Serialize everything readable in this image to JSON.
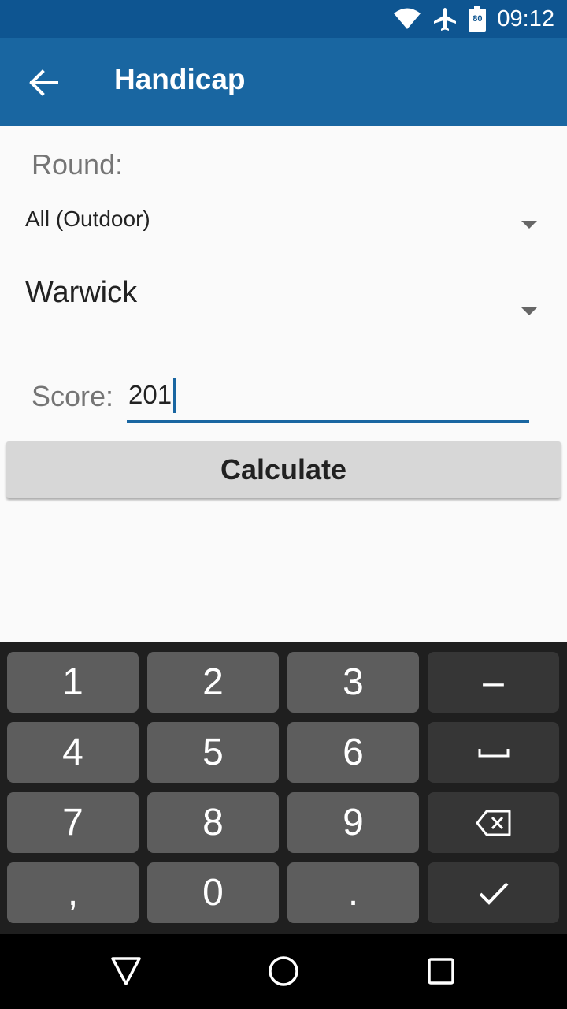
{
  "status_bar": {
    "time": "09:12",
    "battery_level": "80",
    "icons": [
      "wifi-icon",
      "airplane-icon",
      "battery-icon"
    ]
  },
  "app_bar": {
    "title": "Handicap",
    "back_icon": "arrow-left-icon"
  },
  "form": {
    "round_label": "Round:",
    "round_category": "All (Outdoor)",
    "round_name": "Warwick",
    "score_label": "Score:",
    "score_value": "201",
    "calculate_label": "Calculate"
  },
  "keyboard": {
    "keys": {
      "k1": "1",
      "k2": "2",
      "k3": "3",
      "minus": "–",
      "k4": "4",
      "k5": "5",
      "k6": "6",
      "k7": "7",
      "k8": "8",
      "k9": "9",
      "comma": ",",
      "k0": "0",
      "period": "."
    },
    "icons": [
      "space-icon",
      "backspace-icon",
      "checkmark-icon"
    ]
  },
  "nav_bar": {
    "icons": [
      "back-triangle-icon",
      "home-circle-icon",
      "recents-square-icon"
    ]
  },
  "colors": {
    "status_bar": "#0e5591",
    "app_bar": "#1966a1",
    "accent": "#1966a1",
    "keyboard_bg": "#1f1f1f",
    "key": "#5d5d5d",
    "key_dark": "#363636"
  }
}
